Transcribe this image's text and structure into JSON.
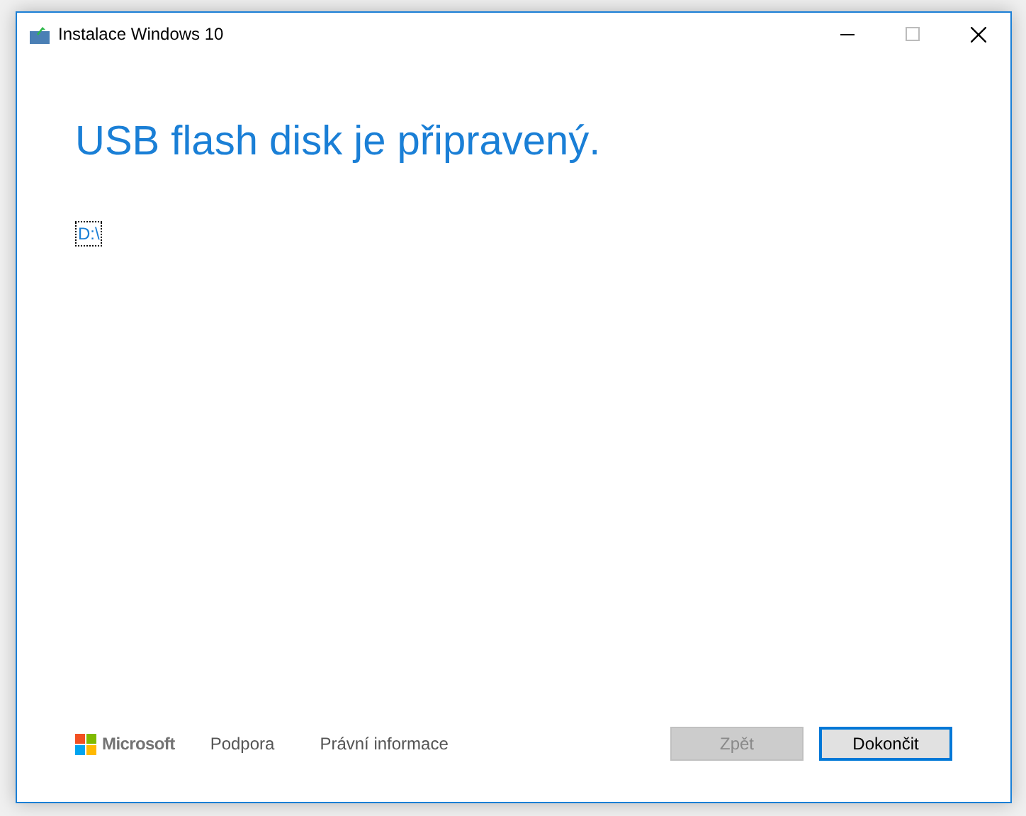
{
  "window": {
    "title": "Instalace Windows 10"
  },
  "heading": "USB flash disk je připravený.",
  "drives": [
    {
      "label": "D:\\",
      "selected": true
    }
  ],
  "footer": {
    "brand": "Microsoft",
    "links": [
      "Podpora",
      "Právní informace"
    ]
  },
  "buttons": [
    {
      "label": "Zpět",
      "disabled": true,
      "focused": false
    },
    {
      "label": "Dokončit",
      "disabled": false,
      "focused": true
    }
  ]
}
